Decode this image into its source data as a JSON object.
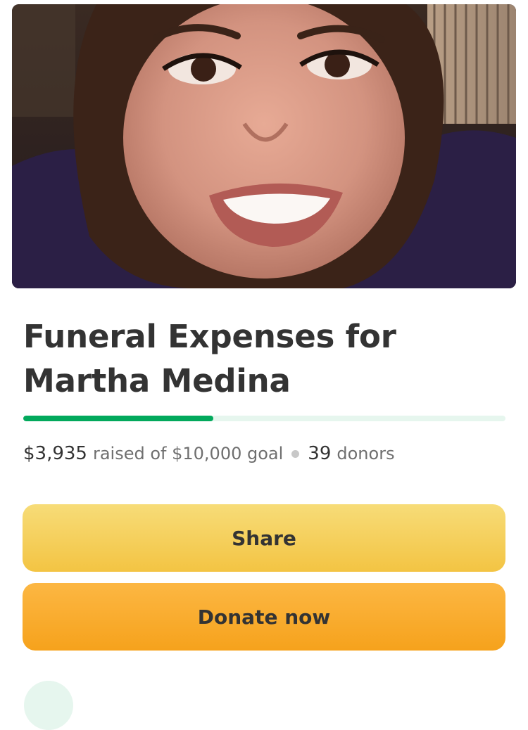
{
  "campaign": {
    "title": "Funeral Expenses for Martha Medina",
    "raised": "$3,935",
    "raised_text": "raised of $10,000 goal",
    "donor_count": "39",
    "donors_label": "donors",
    "progress_fraction": 0.3935
  },
  "actions": {
    "share_label": "Share",
    "donate_label": "Donate now"
  },
  "colors": {
    "progress_fill": "#02a95c",
    "progress_track": "#e6f6ee",
    "share_button": "#f5d05e",
    "donate_button": "#f9ac2e",
    "text_primary": "#333333",
    "text_secondary": "#6f6f6f"
  }
}
